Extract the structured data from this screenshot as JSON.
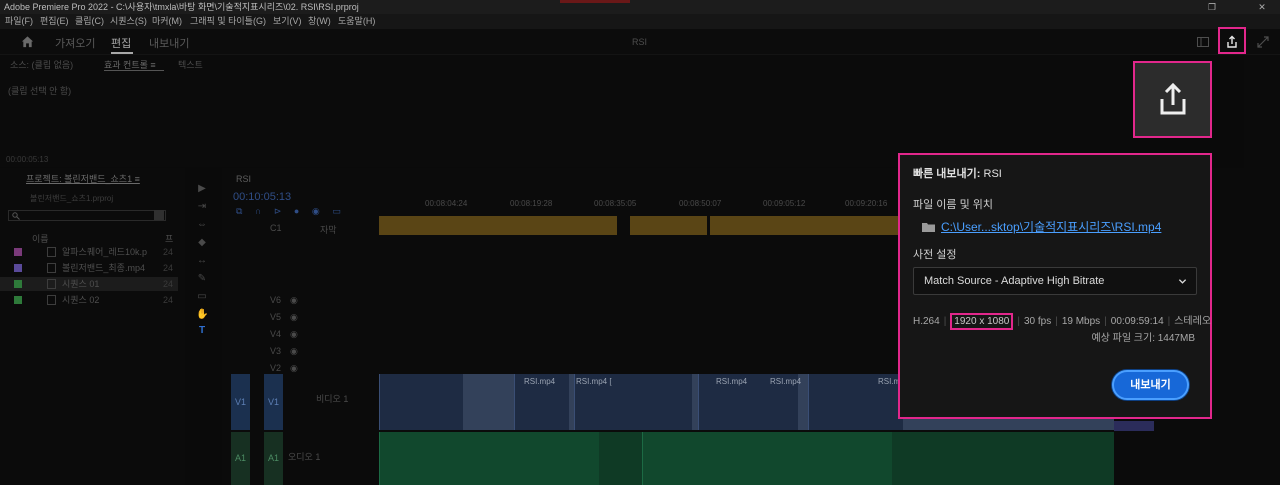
{
  "app": {
    "title": "Adobe Premiere Pro 2022 - C:\\사용자\\tmxla\\바탕 화면\\기술적지표시리즈\\02. RSI\\RSI.prproj"
  },
  "menu": [
    "파일(F)",
    "편집(E)",
    "클립(C)",
    "시퀀스(S)",
    "마커(M)",
    "그래픽 및 타이틀(G)",
    "보기(V)",
    "창(W)",
    "도움말(H)"
  ],
  "header": {
    "tabs": [
      "가져오기",
      "편집",
      "내보내기"
    ],
    "active_tab": "편집",
    "center_title": "RSI"
  },
  "source_panel": {
    "tabs": [
      "소스: (클립 없음)",
      "효과 컨트롤 ≡",
      "텍스트"
    ],
    "no_selection": "(클립 선택 안 함)",
    "timecode": "00:00:05:13"
  },
  "project_panel": {
    "title": "프로젝트: 볼린저밴드_쇼츠1 ≡",
    "file": "볼린저밴드_쇼츠1.prproj",
    "column_name": "이름",
    "column_fr": "프",
    "items": [
      {
        "label": "알파스퀘어_레드10k.p",
        "num": "24",
        "color": "#7a3a7a"
      },
      {
        "label": "볼린저밴드_최종.mp4",
        "num": "24",
        "color": "#5a4a9a"
      },
      {
        "label": "시퀀스 01",
        "num": "24",
        "color": "#2e7a3a"
      },
      {
        "label": "시퀀스 02",
        "num": "24",
        "color": "#2e7a3a"
      }
    ]
  },
  "timeline": {
    "sequence_tab": "RSI",
    "timecode": "00:10:05:13",
    "ruler": [
      "00:08:04:24",
      "00:08:19:28",
      "00:08:35:05",
      "00:08:50:07",
      "00:09:05:12",
      "00:09:20:16"
    ],
    "caption_track": "C1",
    "caption_label": "자막",
    "video_tracks": [
      "V6",
      "V5",
      "V4",
      "V3",
      "V2"
    ],
    "v1": {
      "label": "V1",
      "name": "비디오 1"
    },
    "a1": {
      "label": "A1",
      "name": "오디오 1"
    },
    "clip_labels": [
      "RSI.mp4",
      "RSI.mp4 [",
      "RSI.mp4",
      "RSI.mp4",
      "RSI.mp4"
    ]
  },
  "quick_export": {
    "title_bold": "빠른 내보내기:",
    "title_name": "RSI",
    "file_label": "파일 이름 및 위치",
    "path": "C:\\User...sktop\\기술적지표시리즈\\RSI.mp4",
    "preset_label": "사전 설정",
    "preset_value": "Match Source - Adaptive High Bitrate",
    "codec": "H.264",
    "resolution": "1920 x 1080",
    "fps": "30 fps",
    "bitrate": "19 Mbps",
    "duration": "00:09:59:14",
    "audio": "스테레오",
    "estimate": "예상 파일 크기: 1447MB",
    "export_button": "내보내기"
  },
  "colors": {
    "highlight": "#e2278c",
    "accent": "#1768d8",
    "link": "#4a9fff"
  }
}
